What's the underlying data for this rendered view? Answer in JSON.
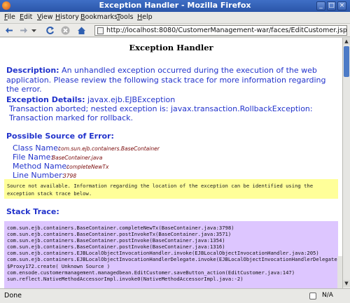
{
  "window": {
    "title": "Exception Handler - Mozilla Firefox"
  },
  "menu": [
    "File",
    "Edit",
    "View",
    "History",
    "Bookmarks",
    "Tools",
    "Help"
  ],
  "toolbar": {
    "url": "http://localhost:8080/CustomerManagement-war/faces/EditCustomer.jsp"
  },
  "page": {
    "heading": "Exception Handler",
    "description_label": "Description:",
    "description_text": " An unhandled exception occurred during the execution of the web application. Please review the following stack trace for more information regarding the error.",
    "details_label": "Exception Details:",
    "details_class": " javax.ejb.EJBException",
    "details_message": "Transaction aborted; nested exception is: javax.transaction.RollbackException: Transaction marked for rollback.",
    "source_heading": "Possible Source of Error:",
    "class_label": "Class Name:",
    "class_value": "com.sun.ejb.containers.BaseContainer",
    "file_label": "File Name:",
    "file_value": "BaseContainer.java",
    "method_label": "Method Name:",
    "method_value": "completeNewTx",
    "line_label": "Line Number:",
    "line_value": "3798",
    "source_note": "Source not available. Information regarding the location of the exception can be identified using the exception stack trace below.",
    "stack_heading": "Stack Trace:",
    "stack_lines": [
      "com.sun.ejb.containers.BaseContainer.completeNewTx(BaseContainer.java:3798)",
      "com.sun.ejb.containers.BaseContainer.postInvokeTx(BaseContainer.java:3571)",
      "com.sun.ejb.containers.BaseContainer.postInvoke(BaseContainer.java:1354)",
      "com.sun.ejb.containers.BaseContainer.postInvoke(BaseContainer.java:1316)",
      "com.sun.ejb.containers.EJBLocalObjectInvocationHandler.invoke(EJBLocalObjectInvocationHandler.java:205)",
      "com.sun.ejb.containers.EJBLocalObjectInvocationHandlerDelegate.invoke(EJBLocalObjectInvocationHandlerDelegate.j",
      "$Proxy172.create( Unknown Source )",
      "com.ensode.customermanagement.managedbean.EditCustomer.saveButton_action(EditCustomer.java:147)",
      "sun.reflect.NativeMethodAccessorImpl.invoke0(NativeMethodAccessorImpl.java:-2)"
    ]
  },
  "status": {
    "text": "Done",
    "right": "N/A"
  }
}
